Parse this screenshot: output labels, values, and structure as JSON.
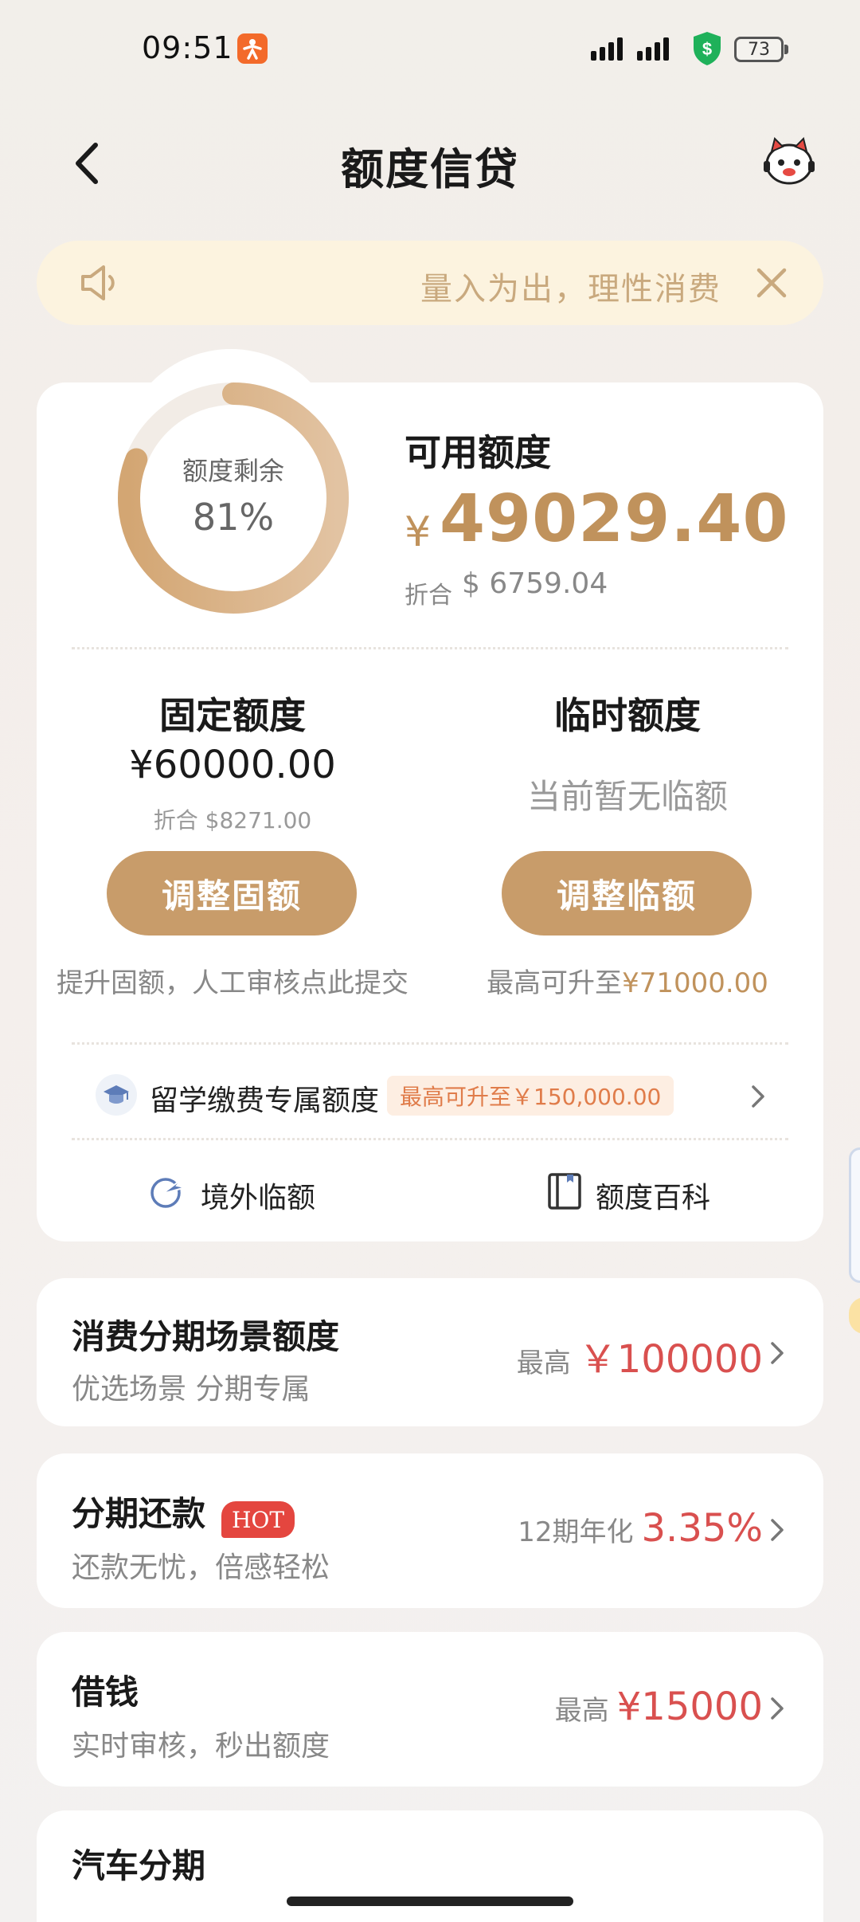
{
  "status_bar": {
    "time": "09:51",
    "battery": "73"
  },
  "header": {
    "title": "额度信贷"
  },
  "notice": {
    "text": "量入为出，理性消费"
  },
  "summary": {
    "ring_label": "额度剩余",
    "ring_percent": "81%",
    "ring_fraction": 0.81,
    "available_label": "可用额度",
    "currency_symbol": "¥",
    "available_amount": "49029.40",
    "usd_label": "折合",
    "usd_amount": "$ 6759.04"
  },
  "fixed": {
    "title": "固定额度",
    "amount": "¥60000.00",
    "usd": "折合 $8271.00",
    "button": "调整固额",
    "note": "提升固额，人工审核点此提交"
  },
  "temporary": {
    "title": "临时额度",
    "status": "当前暂无临额",
    "button": "调整临额",
    "note_prefix": "最高可升至",
    "note_amount": "¥71000.00"
  },
  "study": {
    "label": "留学缴费专属额度",
    "tag": "最高可升至￥150,000.00"
  },
  "links": {
    "overseas": "境外临额",
    "wiki": "额度百科"
  },
  "products": [
    {
      "title": "消费分期场景额度",
      "subtitle": "优选场景 分期专属",
      "prefix": "最高",
      "value": "￥100000"
    },
    {
      "title": "分期还款",
      "badge": "HOT",
      "subtitle": "还款无忧，倍感轻松",
      "prefix": "12期年化",
      "value": "3.35%"
    },
    {
      "title": "借钱",
      "subtitle": "实时审核，秒出额度",
      "prefix": "最高",
      "value": "¥15000"
    },
    {
      "title": "汽车分期",
      "subtitle": "",
      "prefix": "",
      "value": ""
    }
  ],
  "colors": {
    "gold": "#c0925c",
    "button": "#c89c6a",
    "red": "#d9504f",
    "notice_bg": "#fcf3df"
  }
}
